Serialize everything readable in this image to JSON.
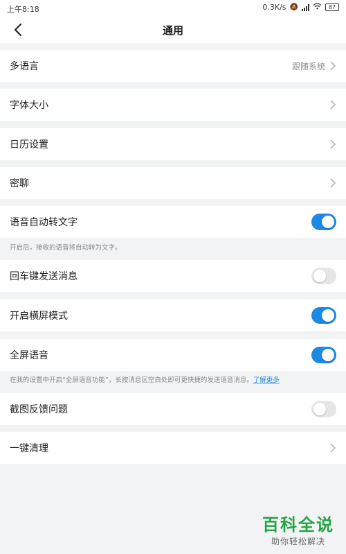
{
  "status_bar": {
    "time": "上午8:18",
    "net_speed": "0.3K/s",
    "battery": "87"
  },
  "header": {
    "title": "通用",
    "back_icon": "chevron-left-icon"
  },
  "settings": {
    "multilanguage": {
      "label": "多语言",
      "value": "跟随系统"
    },
    "font_size": {
      "label": "字体大小"
    },
    "calendar": {
      "label": "日历设置"
    },
    "secret_chat": {
      "label": "密聊"
    },
    "voice_to_text": {
      "label": "语音自动转文字",
      "enabled": true
    },
    "voice_to_text_note": "开启后，接收的语音将自动转为文字。",
    "enter_send": {
      "label": "回车键发送消息",
      "enabled": false
    },
    "landscape": {
      "label": "开启横屏模式",
      "enabled": true
    },
    "fullscreen_voice": {
      "label": "全屏语音",
      "enabled": true
    },
    "fullscreen_voice_note": "在我的设置中开启“全屏语音功能”，长按消息区空白处即可更快捷的发送语音消息。",
    "fullscreen_voice_link": "了解更多",
    "screenshot_feedback": {
      "label": "截图反馈问题",
      "enabled": false
    },
    "one_click_clean": {
      "label": "一键清理"
    }
  },
  "watermark": {
    "title": "百科全说",
    "subtitle": "助你轻松解决"
  },
  "colors": {
    "accent": "#1e88e5",
    "toggle_off": "#e6e6e6",
    "background": "#f2f3f5",
    "watermark": "#26a446"
  }
}
